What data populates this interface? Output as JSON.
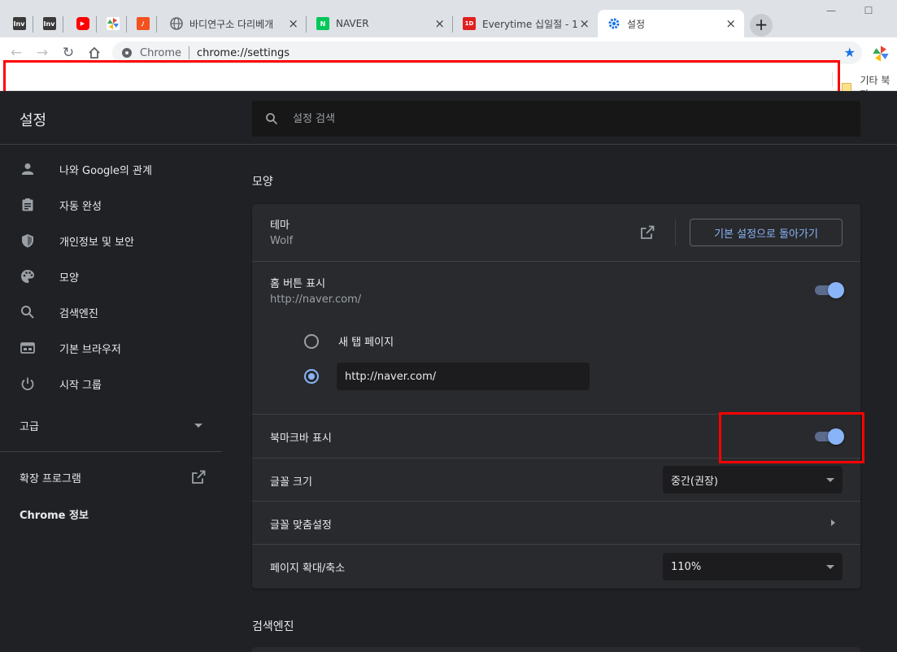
{
  "browser": {
    "tabs": [
      {
        "type": "pinned",
        "favicon": "inven-icon",
        "favicon_text": "Inv",
        "favicon_color": "#3a3a3a"
      },
      {
        "type": "pinned",
        "favicon": "inven-icon",
        "favicon_text": "Inv",
        "favicon_color": "#3a3a3a"
      },
      {
        "type": "pinned",
        "favicon": "youtube-icon",
        "favicon_text": "▶",
        "favicon_color": "#ff0000"
      },
      {
        "type": "pinned",
        "favicon": "pinwheel-icon",
        "favicon_text": "",
        "favicon_color": "#ffffff"
      },
      {
        "type": "pinned",
        "favicon": "orange-app-icon",
        "favicon_text": "ﾉ",
        "favicon_color": "#f4511e"
      },
      {
        "type": "normal",
        "favicon": "globe-icon",
        "title": "바디연구소 다리베개",
        "active": false
      },
      {
        "type": "normal",
        "favicon": "naver-icon",
        "title": "NAVER",
        "active": false
      },
      {
        "type": "normal",
        "favicon": "everytime-icon",
        "title": "Everytime 십일절 - 1",
        "active": false
      },
      {
        "type": "normal",
        "favicon": "settings-gear-icon",
        "title": "설정",
        "active": true
      }
    ],
    "omnibox": {
      "site_label": "Chrome",
      "url": "chrome://settings"
    },
    "bookmarks_bar": {
      "other_bookmarks": "기타 북마"
    }
  },
  "settings": {
    "title": "설정",
    "search_placeholder": "설정 검색",
    "sidebar": {
      "items": [
        {
          "name": "person",
          "icon": "person-icon",
          "label": "나와 Google의 관계"
        },
        {
          "name": "autofill",
          "icon": "clipboard-icon",
          "label": "자동 완성"
        },
        {
          "name": "privacy",
          "icon": "shield-icon",
          "label": "개인정보 및 보안"
        },
        {
          "name": "appearance",
          "icon": "palette-icon",
          "label": "모양"
        },
        {
          "name": "search-engine",
          "icon": "search-icon",
          "label": "검색엔진"
        },
        {
          "name": "default-browser",
          "icon": "browser-window-icon",
          "label": "기본 브라우저"
        },
        {
          "name": "on-startup",
          "icon": "power-icon",
          "label": "시작 그룹"
        }
      ],
      "advanced": "고급",
      "extensions": "확장 프로그램",
      "about": "Chrome 정보"
    },
    "appearance": {
      "section_title": "모양",
      "theme_label": "테마",
      "theme_value": "Wolf",
      "reset_button": "기본 설정으로 돌아가기",
      "home_button_label": "홈 버튼 표시",
      "home_button_sub": "http://naver.com/",
      "home_button_enabled": true,
      "radio_new_tab": "새 탭 페이지",
      "radio_custom_value": "http://naver.com/",
      "radio_selected": "custom",
      "bookmarks_bar_label": "북마크바 표시",
      "bookmarks_bar_enabled": true,
      "font_size_label": "글꼴 크기",
      "font_size_value": "중간(권장)",
      "customize_fonts_label": "글꼴 맞춤설정",
      "page_zoom_label": "페이지 확대/축소",
      "page_zoom_value": "110%"
    },
    "search_engine_section": "검색엔진"
  },
  "colors": {
    "accent": "#8ab4f8",
    "background": "#202124",
    "card": "#292a2d",
    "highlight": "#ff0000"
  }
}
